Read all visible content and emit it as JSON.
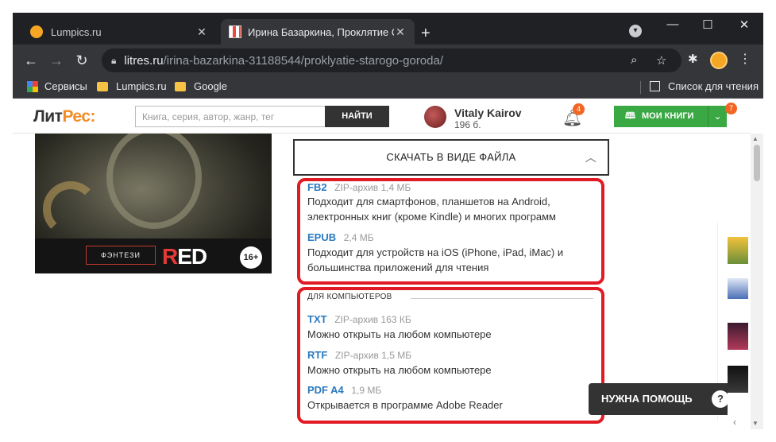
{
  "browser": {
    "tabs": [
      {
        "title": "Lumpics.ru",
        "active": false
      },
      {
        "title": "Ирина Базаркина, Проклятие С",
        "active": true
      }
    ],
    "url_host": "litres.ru",
    "url_path": "/irina-bazarkina-31188544/proklyatie-starogo-goroda/",
    "bookmarks": [
      "Сервисы",
      "Lumpics.ru",
      "Google"
    ],
    "reading_list": "Список для чтения"
  },
  "site": {
    "logo_part1": "Лит",
    "logo_part2": "Рес:",
    "search_placeholder": "Книга, серия, автор, жанр, тег",
    "search_button": "НАЙТИ",
    "user_name": "Vitaly Kairov",
    "user_points": "196 б.",
    "notifications_count": "4",
    "my_books_label": "МОИ КНИГИ",
    "my_books_count": "7"
  },
  "cover": {
    "genre": "ФЭНТЕЗИ",
    "imprint_r": "R",
    "imprint_rest": "ED",
    "age_rating": "16+"
  },
  "download": {
    "button_label": "СКАЧАТЬ В ВИДЕ ФАЙЛА",
    "mobile_formats": [
      {
        "name": "FB2",
        "meta": "ZIP-архив 1,4 МБ",
        "desc": "Подходит для смартфонов, планшетов на Android, электронных книг (кроме Kindle) и многих программ"
      },
      {
        "name": "EPUB",
        "meta": "2,4 МБ",
        "desc": "Подходит для устройств на iOS (iPhone, iPad, iMac) и большинства приложений для чтения"
      }
    ],
    "computer_section_title": "ДЛЯ КОМПЬЮТЕРОВ",
    "computer_formats": [
      {
        "name": "TXT",
        "meta": "ZIP-архив 163 КБ",
        "desc": "Можно открыть на любом компьютере"
      },
      {
        "name": "RTF",
        "meta": "ZIP-архив 1,5 МБ",
        "desc": "Можно открыть на любом компьютере"
      },
      {
        "name": "PDF A4",
        "meta": "1,9 МБ",
        "desc": "Открывается в программе Adobe Reader"
      }
    ]
  },
  "help_label": "НУЖНА ПОМОЩЬ",
  "colors": {
    "highlight": "#e01b24",
    "link": "#2a7ac0",
    "brand_orange": "#f28c28",
    "green": "#3aa843"
  }
}
